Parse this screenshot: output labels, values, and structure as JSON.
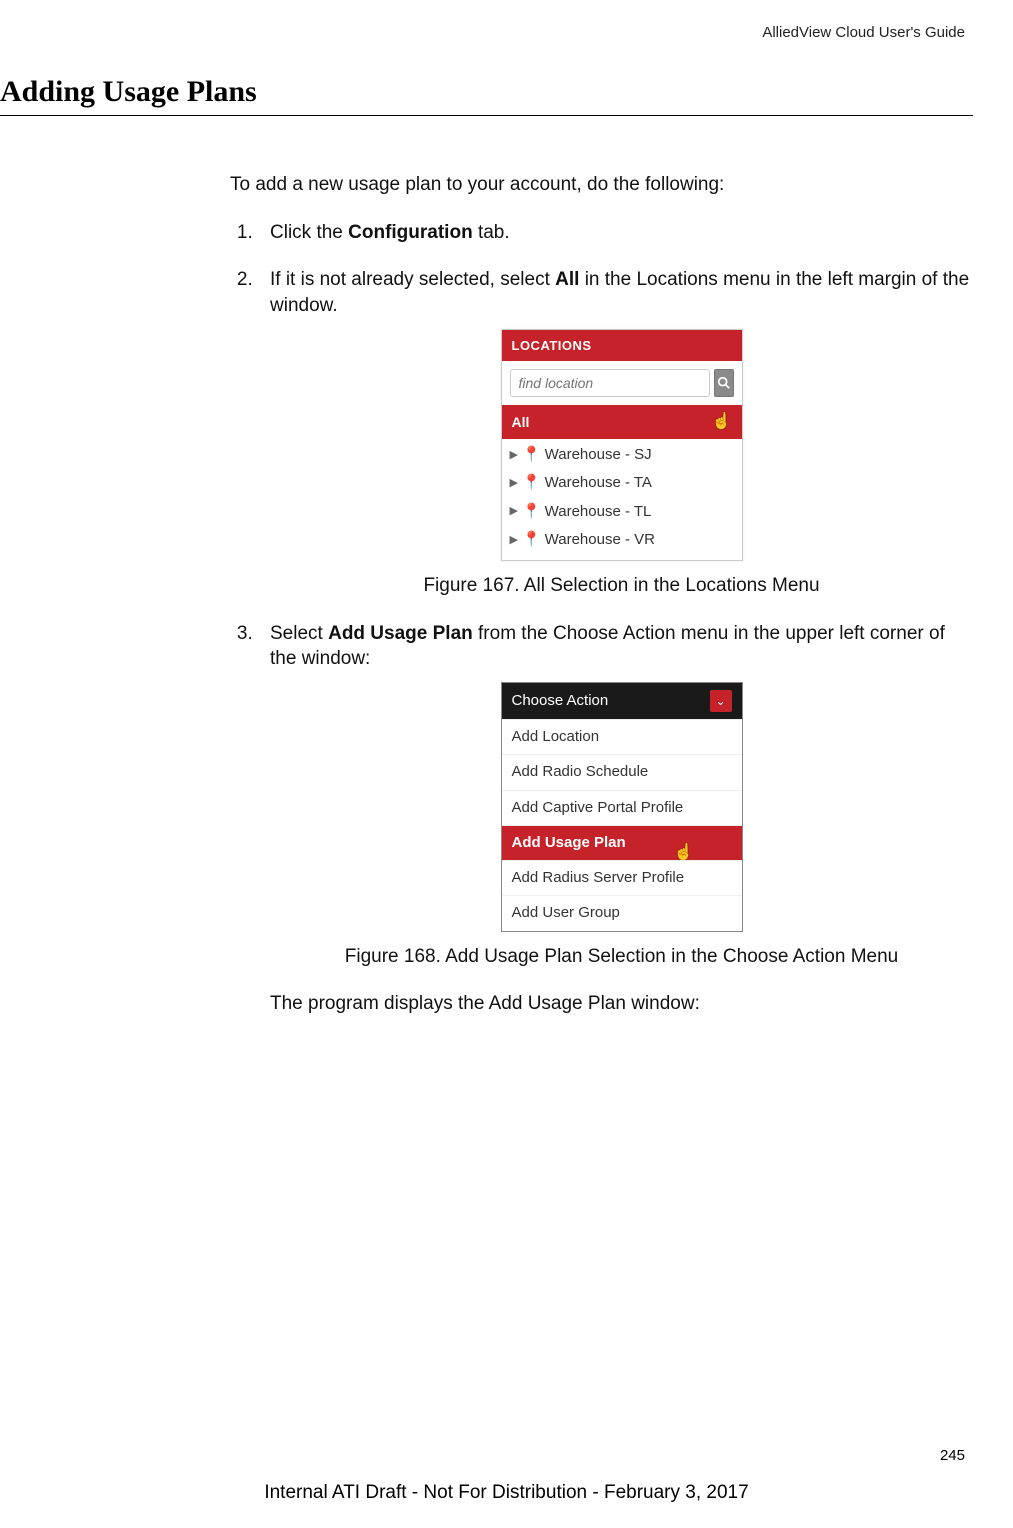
{
  "header": {
    "guide": "AlliedView Cloud User's Guide"
  },
  "section": {
    "title": "Adding Usage Plans"
  },
  "intro": "To add a new usage plan to your account, do the following:",
  "steps": {
    "s1": {
      "pre": "Click the ",
      "bold": "Configuration",
      "post": " tab."
    },
    "s2": {
      "pre": "If it is not already selected, select ",
      "bold": "All",
      "post": " in the Locations menu in the left margin of the window."
    },
    "s3": {
      "pre": "Select ",
      "bold": "Add Usage Plan",
      "post": " from the Choose Action menu in the upper left corner of the window:"
    }
  },
  "locations_panel": {
    "header": "LOCATIONS",
    "search_placeholder": "find location",
    "all_label": "All",
    "items": [
      "Warehouse - SJ",
      "Warehouse - TA",
      "Warehouse - TL",
      "Warehouse - VR"
    ]
  },
  "fig1_caption": "Figure 167. All Selection in the Locations Menu",
  "action_menu": {
    "header": "Choose Action",
    "items": [
      {
        "label": "Add Location",
        "selected": false
      },
      {
        "label": "Add Radio Schedule",
        "selected": false
      },
      {
        "label": "Add Captive Portal Profile",
        "selected": false
      },
      {
        "label": "Add Usage Plan",
        "selected": true
      },
      {
        "label": "Add Radius Server Profile",
        "selected": false
      },
      {
        "label": "Add User Group",
        "selected": false
      }
    ]
  },
  "fig2_caption": "Figure 168. Add Usage Plan Selection in the Choose Action Menu",
  "after": "The program displays the Add Usage Plan window:",
  "page_number": "245",
  "footer": "Internal ATI Draft - Not For Distribution - February 3, 2017"
}
